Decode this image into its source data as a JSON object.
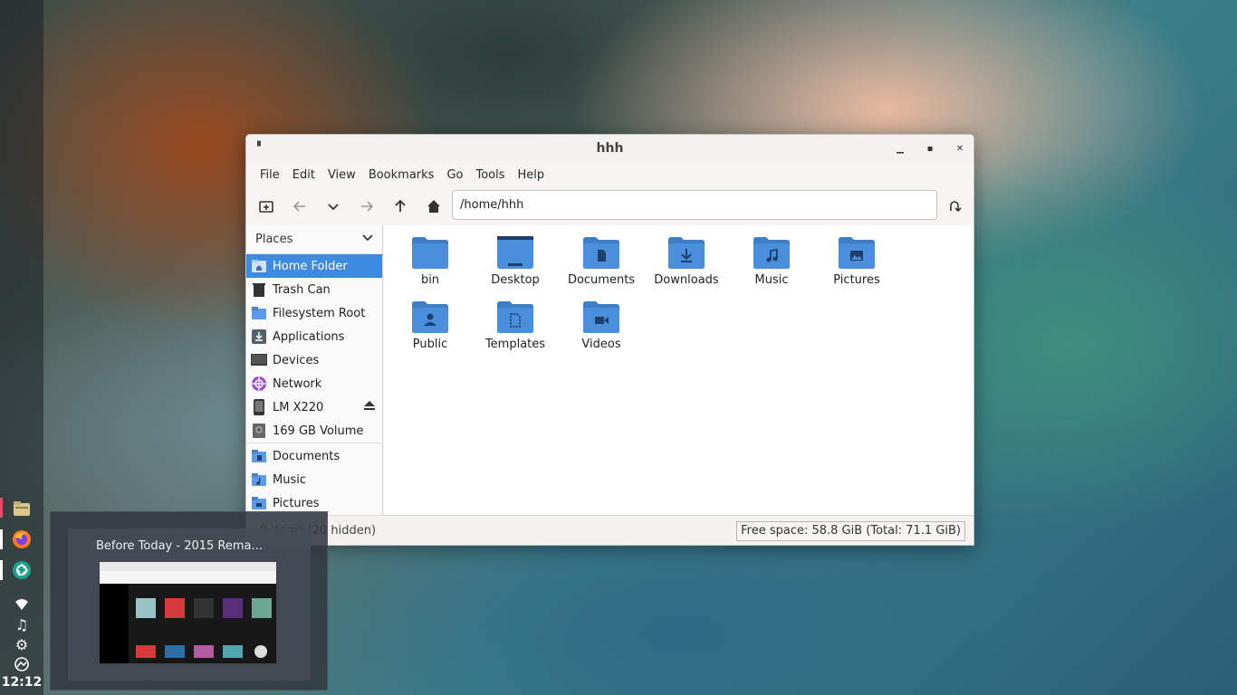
{
  "dock": {
    "apps": [
      {
        "name": "file-manager-icon"
      },
      {
        "name": "firefox-icon"
      },
      {
        "name": "camera-aperture-icon"
      }
    ],
    "tray": [
      {
        "name": "wifi-icon",
        "glyph": "▼"
      },
      {
        "name": "music-icon",
        "glyph": "♫"
      },
      {
        "name": "gear-icon",
        "glyph": "⚙"
      },
      {
        "name": "drive-icon",
        "glyph": "◒"
      }
    ],
    "clock": "12:12"
  },
  "window": {
    "title": "hhh",
    "menu": [
      "File",
      "Edit",
      "View",
      "Bookmarks",
      "Go",
      "Tools",
      "Help"
    ],
    "location": "/home/hhh",
    "sidebar": {
      "header": "Places",
      "items": [
        {
          "label": "Home Folder",
          "icon": "home-folder-icon",
          "selected": true
        },
        {
          "label": "Trash Can",
          "icon": "trash-icon"
        },
        {
          "label": "Filesystem Root",
          "icon": "folder-icon"
        },
        {
          "label": "Applications",
          "icon": "applications-icon"
        },
        {
          "label": "Devices",
          "icon": "monitor-icon"
        },
        {
          "label": "Network",
          "icon": "network-icon"
        },
        {
          "label": "LM X220",
          "icon": "phone-icon",
          "eject": true
        },
        {
          "label": "169 GB Volume",
          "icon": "drive-icon"
        }
      ],
      "bookmarks": [
        {
          "label": "Documents",
          "icon": "documents-folder-icon"
        },
        {
          "label": "Music",
          "icon": "music-folder-icon"
        },
        {
          "label": "Pictures",
          "icon": "pictures-folder-icon"
        }
      ]
    },
    "files": [
      {
        "name": "bin",
        "emblem": "none"
      },
      {
        "name": "Desktop",
        "emblem": "desktop"
      },
      {
        "name": "Documents",
        "emblem": "doc"
      },
      {
        "name": "Downloads",
        "emblem": "download"
      },
      {
        "name": "Music",
        "emblem": "music"
      },
      {
        "name": "Pictures",
        "emblem": "picture"
      },
      {
        "name": "Public",
        "emblem": "person"
      },
      {
        "name": "Templates",
        "emblem": "template"
      },
      {
        "name": "Videos",
        "emblem": "video"
      }
    ],
    "status_left": "9 items (20 hidden)",
    "status_right": "Free space: 58.8 GiB (Total: 71.1 GiB)"
  },
  "preview": {
    "title": "Before Today - 2015 Rema..."
  },
  "colors": {
    "folder": "#4a8fdc",
    "folder_tab": "#3f7ec7",
    "selected": "#3d8ae0"
  }
}
